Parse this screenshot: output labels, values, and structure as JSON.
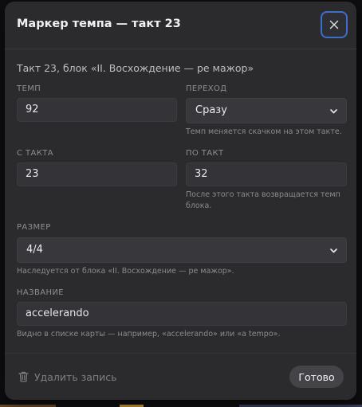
{
  "dialog": {
    "title": "Маркер темпа — такт 23",
    "subtitle": "Такт 23, блок «II. Восхождение — ре мажор»"
  },
  "fields": {
    "tempo": {
      "label": "ТЕМП",
      "value": "92"
    },
    "transition": {
      "label": "ПЕРЕХОД",
      "selected": "Сразу",
      "hint": "Темп меняется скачком на этом такте."
    },
    "from_bar": {
      "label": "С ТАКТА",
      "value": "23"
    },
    "to_bar": {
      "label": "ПО ТАКТ",
      "value": "32",
      "hint": "После этого такта возвращается темп блока."
    },
    "meter": {
      "label": "РАЗМЕР",
      "selected": "4/4",
      "hint": "Наследуется от блока «II. Восхождение — ре мажор»."
    },
    "name": {
      "label": "НАЗВАНИЕ",
      "value": "accelerando",
      "hint": "Видно в списке карты — например, «accelerando» или «a tempo»."
    }
  },
  "footer": {
    "delete_label": "Удалить запись",
    "done_label": "Готово"
  },
  "icons": {
    "close": "close-icon",
    "chevron": "chevron-down-icon",
    "trash": "trash-icon"
  },
  "colors": {
    "dialog_bg": "#2b2b2e",
    "focus_ring": "#3e6ec9",
    "text_primary": "#f0f0f2",
    "text_muted": "#8d8d93"
  }
}
